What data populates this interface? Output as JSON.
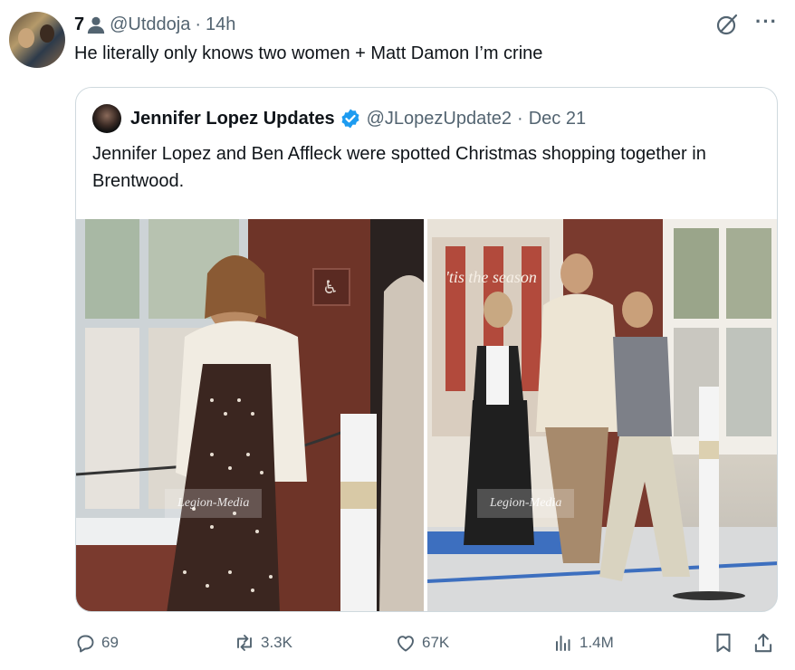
{
  "post": {
    "name": "7",
    "handle": "@Utddoja",
    "separator": "·",
    "time": "14h",
    "text": "He literally only knows two women + Matt Damon I’m crine"
  },
  "quoted": {
    "name": "Jennifer Lopez Updates",
    "handle": "@JLopezUpdate2",
    "separator": "·",
    "date": "Dec 21",
    "text": "Jennifer Lopez and Ben Affleck were spotted Christmas shopping together in Brentwood.",
    "photos": {
      "left_watermark": "Legion-Media",
      "right_watermark": "Legion-Media",
      "storefront_sign": "'tis the season"
    }
  },
  "actions": {
    "replies": "69",
    "reposts": "3.3K",
    "likes": "67K",
    "views": "1.4M"
  },
  "icons": {
    "person": "person-icon",
    "grok": "grok-icon",
    "more": "more-icon",
    "verified": "verified-badge-icon",
    "reply": "reply-icon",
    "repost": "repost-icon",
    "like": "heart-icon",
    "views": "views-icon",
    "bookmark": "bookmark-icon",
    "share": "share-icon"
  },
  "colors": {
    "text_primary": "#0f1419",
    "text_secondary": "#536471",
    "verified_blue": "#1d9bf0",
    "border": "#cfd9de"
  }
}
